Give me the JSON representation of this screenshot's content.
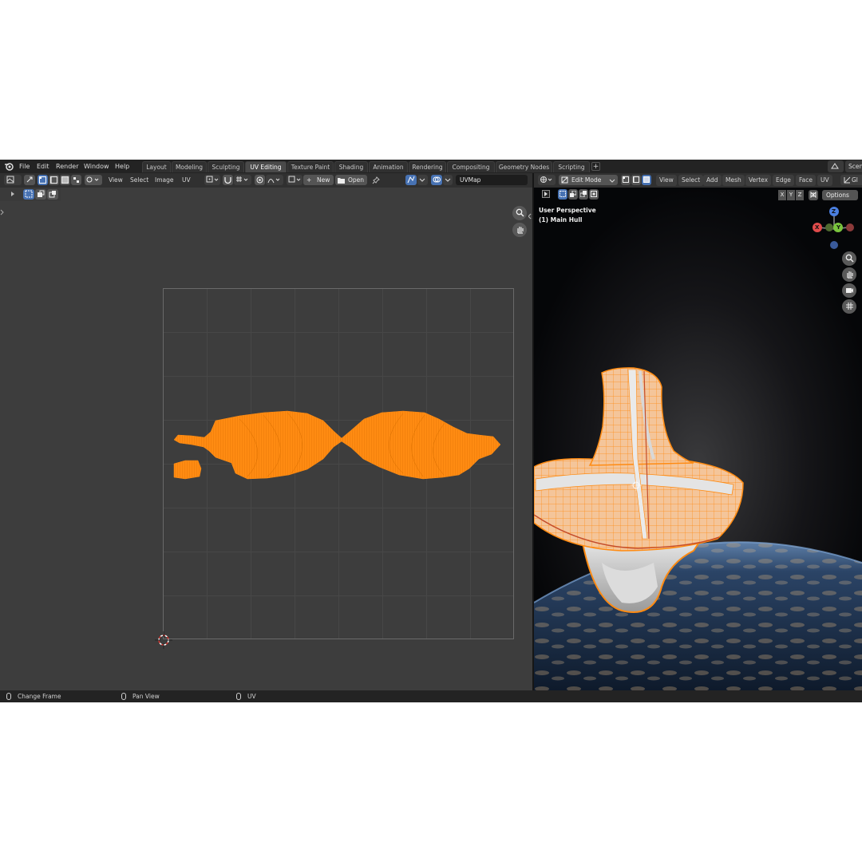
{
  "menus": [
    "File",
    "Edit",
    "Render",
    "Window",
    "Help"
  ],
  "workspaces": [
    {
      "label": "Layout",
      "active": false
    },
    {
      "label": "Modeling",
      "active": false
    },
    {
      "label": "Sculpting",
      "active": false
    },
    {
      "label": "UV Editing",
      "active": true
    },
    {
      "label": "Texture Paint",
      "active": false
    },
    {
      "label": "Shading",
      "active": false
    },
    {
      "label": "Animation",
      "active": false
    },
    {
      "label": "Rendering",
      "active": false
    },
    {
      "label": "Compositing",
      "active": false
    },
    {
      "label": "Geometry Nodes",
      "active": false
    },
    {
      "label": "Scripting",
      "active": false
    }
  ],
  "add_workspace": "+",
  "scene_label": "Scen",
  "view_layer_label": "Gl",
  "uv_editor": {
    "menus": [
      "View",
      "Select",
      "Image",
      "UV"
    ],
    "new_label": "New",
    "open_label": "Open",
    "uvmap_name": "UVMap"
  },
  "viewport": {
    "mode": "Edit Mode",
    "menus": [
      "View",
      "Select",
      "Add",
      "Mesh",
      "Vertex",
      "Edge",
      "Face",
      "UV"
    ],
    "perspective": "User Perspective",
    "object": "(1) Main Hull",
    "axes_lock": [
      "X",
      "Y",
      "Z"
    ],
    "options_label": "Options",
    "gizmo": {
      "x": "X",
      "y": "Y",
      "z": "Z"
    }
  },
  "status_bar": [
    {
      "label": "Change Frame"
    },
    {
      "label": "Pan View"
    },
    {
      "label": "UV"
    }
  ],
  "colors": {
    "selection": "#ff8b12",
    "active_tab": "#4a4a4a",
    "accent_blue": "#4772b3",
    "x_axis": "#e04b4b",
    "y_axis": "#7ac43d",
    "z_axis": "#4a7fe0"
  }
}
